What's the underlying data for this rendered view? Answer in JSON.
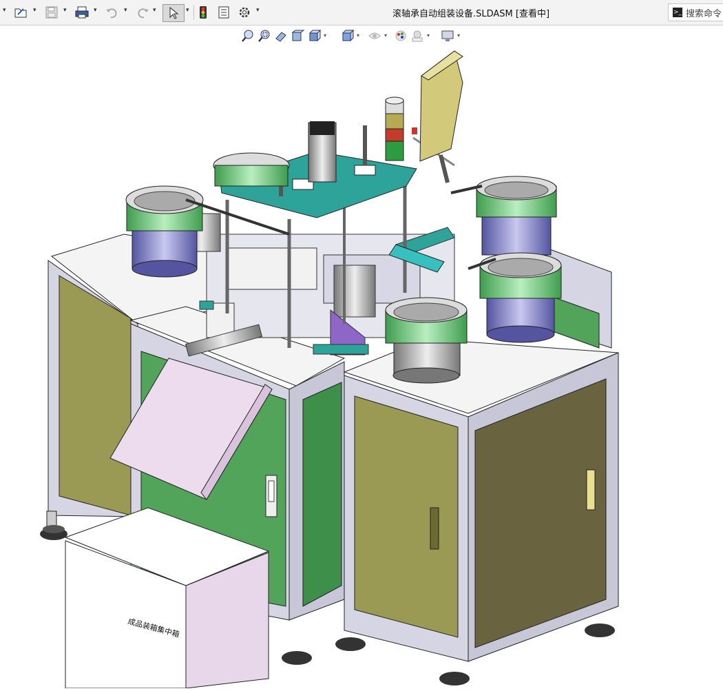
{
  "window": {
    "title": "滚轴承自动组装设备.SLDASM [查看中]"
  },
  "search": {
    "placeholder": "搜索命令",
    "icon": "command-prompt-icon"
  },
  "toolbar": {
    "items": [
      "menu-caret",
      "open-icon",
      "save-icon",
      "print-icon",
      "undo-icon",
      "redo-icon",
      "select-arrow-icon",
      "traffic-light-icon",
      "file-properties-icon",
      "options-gear-icon"
    ]
  },
  "view_toolbar": {
    "items": [
      "zoom-to-fit-icon",
      "zoom-to-area-icon",
      "previous-view-icon",
      "section-view-icon",
      "view-orientation-icon",
      "display-style-icon",
      "hide-show-items-icon",
      "edit-appearance-icon",
      "apply-scene-icon",
      "view-settings-icon"
    ]
  },
  "model": {
    "bin_label": "成品装箱集中箱",
    "colors": {
      "cabinet_door": "#9b9a55",
      "cabinet_green": "#52a45a",
      "frame": "#d8d8e6",
      "plate_teal": "#2ea39a",
      "bowl_green": "#6cc67a",
      "bowl_blue": "#7f7fc2",
      "monitor_yellow": "#d2c97a",
      "bin_pink": "#e8d7ea"
    }
  }
}
